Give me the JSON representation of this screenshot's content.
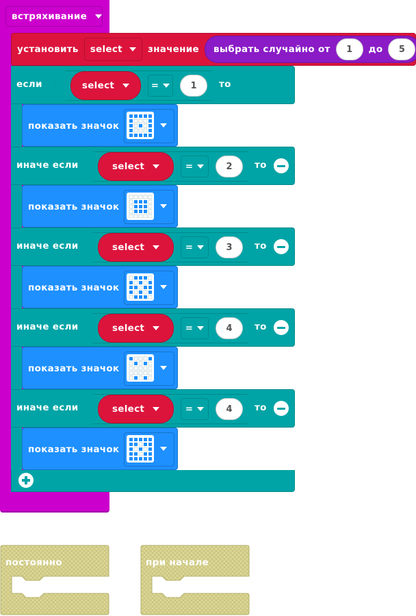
{
  "event": {
    "label": "встряхивание"
  },
  "set_block": {
    "label": "установить",
    "variable": "select",
    "value_label": "значение",
    "random": {
      "label": "выбрать случайно от",
      "from": "1",
      "to_label": "до",
      "to": "5"
    }
  },
  "if_block": {
    "rows": [
      {
        "label": "если",
        "variable": "select",
        "op": "=",
        "value": "1",
        "then": "то"
      },
      {
        "label": "иначе если",
        "variable": "select",
        "op": "=",
        "value": "2",
        "then": "то"
      },
      {
        "label": "иначе если",
        "variable": "select",
        "op": "=",
        "value": "3",
        "then": "то"
      },
      {
        "label": "иначе если",
        "variable": "select",
        "op": "=",
        "value": "4",
        "then": "то"
      },
      {
        "label": "иначе если",
        "variable": "select",
        "op": "=",
        "value": "4",
        "then": "то"
      }
    ],
    "show_label": "показать значок",
    "icons": [
      "small-diamond-icon",
      "square-icon",
      "x-icon",
      "happy-grid-icon",
      "small-square-icon"
    ]
  },
  "ghost_blocks": [
    {
      "label": "постоянно"
    },
    {
      "label": "при начале"
    }
  ],
  "colors": {
    "event": "#cc00cc",
    "variable": "#dc143c",
    "math": "#8a1bc6",
    "logic": "#00a4a6",
    "basic": "#1e90ff",
    "ghost": "#d8d48c"
  }
}
